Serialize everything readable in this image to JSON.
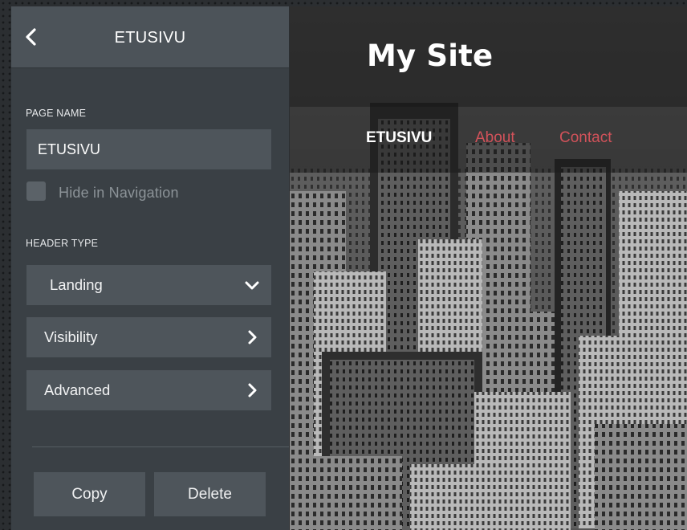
{
  "panel": {
    "title": "ETUSIVU",
    "back_icon": "chevron-left-icon",
    "page_name": {
      "label": "PAGE NAME",
      "value": "ETUSIVU"
    },
    "hide_in_navigation": {
      "label": "Hide in Navigation",
      "checked": false
    },
    "header_type": {
      "label": "HEADER TYPE",
      "selected": "Landing",
      "icon": "chevron-down-icon"
    },
    "rows": [
      {
        "label": "Visibility",
        "icon": "chevron-right-icon"
      },
      {
        "label": "Advanced",
        "icon": "chevron-right-icon"
      }
    ],
    "actions": {
      "copy": "Copy",
      "delete": "Delete"
    }
  },
  "preview": {
    "site_title": "My Site",
    "nav": [
      {
        "label": "ETUSIVU",
        "current": true
      },
      {
        "label": "About",
        "current": false
      },
      {
        "label": "Contact",
        "current": false
      }
    ]
  },
  "colors": {
    "panel_bg": "#3a4045",
    "header_bg": "#4c5359",
    "field_bg": "#4e555b",
    "nav_link": "#d2525a",
    "nav_current": "#ffffff"
  }
}
